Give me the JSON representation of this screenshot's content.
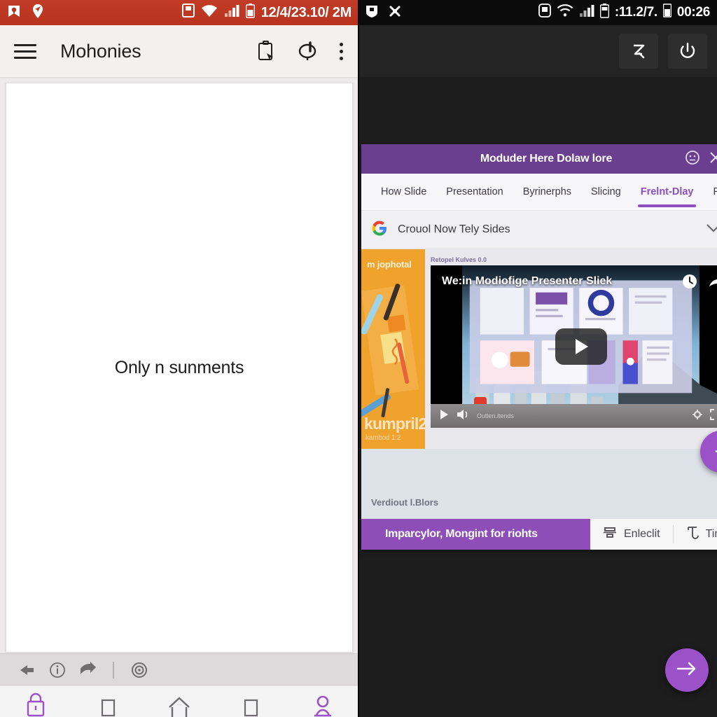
{
  "left_panel": {
    "status_bar": {
      "icons": [
        "notification-icon",
        "location-pin-icon"
      ],
      "network_icons": [
        "sd-card-icon",
        "wifi-icon",
        "signal-icon",
        "battery-icon"
      ],
      "text": "12/4/23.10/ 2M",
      "background_color": "#c0392b"
    },
    "toolbar": {
      "menu_icon": "hamburger-menu-icon",
      "title": "Mohonies",
      "icons": [
        "clipboard-select-icon",
        "lasso-pointer-icon",
        "overflow-menu-icon"
      ]
    },
    "canvas": {
      "empty_text": "Only n sunments"
    },
    "bottom_tools": {
      "icons": [
        "back-arrow-icon",
        "info-icon",
        "share-icon",
        "target-icon"
      ]
    },
    "nav_bar": {
      "items": [
        "lock-icon",
        "square-icon",
        "home-icon",
        "recents-icon",
        "person-icon"
      ],
      "accent_color": "#8b4fc0"
    }
  },
  "right_panel": {
    "status_bar": {
      "icons": [
        "shield-icon",
        "bluetooth-icon"
      ],
      "network_icons": [
        "sd-card-icon",
        "wifi-icon",
        "signal-icon",
        "battery-icon"
      ],
      "text_left": ":11.2/7.",
      "time": "00:26",
      "background_color": "#0b0b0b"
    },
    "top_bar": {
      "buttons": [
        "zoom-z-icon",
        "power-icon"
      ]
    },
    "card": {
      "header": {
        "title": "Moduder Here Dolaw lore",
        "icons": [
          "face-emoji-icon",
          "close-icon"
        ],
        "background_color": "#6b3f8f"
      },
      "tabs": [
        {
          "label": "How Slide",
          "active": false
        },
        {
          "label": "Presentation",
          "active": false
        },
        {
          "label": "Byrinerphs",
          "active": false
        },
        {
          "label": "Slicing",
          "active": false
        },
        {
          "label": "Frelnt-Dlay",
          "active": true
        },
        {
          "label": "Facel",
          "active": false
        }
      ],
      "search_row": {
        "icon": "google-g-icon",
        "text": "Crouol Now Tely Sides",
        "chevron": "chevron-down-icon"
      },
      "thumbnail_card": {
        "top_label": "m jophotal",
        "title": "kumpril2",
        "subtitle": "kambod 1:2",
        "background_color": "#f0a32c"
      },
      "video": {
        "label": "Retopel Kulves 0.0",
        "title": "We:in Modiofige Presenter Sliek",
        "top_icons": [
          "clock-icon",
          "share-forward-icon"
        ],
        "play_icon": "play-button-icon",
        "controls": [
          "play-icon",
          "volume-icon",
          "settings-icon",
          "fullscreen-icon"
        ],
        "progress_text": "Outlen.itends"
      },
      "below_text": "Verdiout l.Blors",
      "fab_plus": "+",
      "action_bar": {
        "primary_label": "Imparcylor, Mongint for riohts",
        "primary_color": "#8e4eb8",
        "buttons": [
          {
            "label": "Enleclit",
            "icon": "align-icon"
          },
          {
            "label": "Tinis",
            "icon": "text-format-icon"
          }
        ]
      }
    },
    "fab_arrow": "arrow-right-icon",
    "accent_color": "#9b51c8"
  }
}
